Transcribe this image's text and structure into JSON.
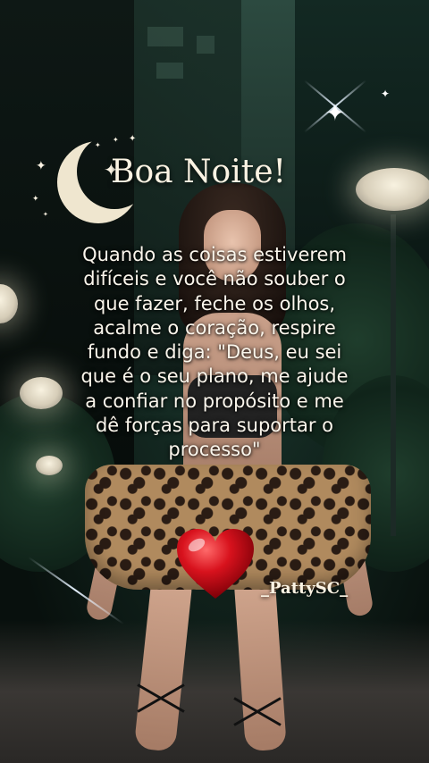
{
  "greeting": {
    "title": "Boa Noite!"
  },
  "message": {
    "lines": [
      "Quando as coisas estiverem",
      "difíceis e você não souber o",
      "que fazer, feche os olhos,",
      "acalme o coração, respire",
      "fundo e diga: \"Deus, eu sei",
      "que é o seu plano, me ajude",
      "a confiar no propósito e me",
      "dê forças para suportar o",
      "processo\""
    ]
  },
  "signature": "_PattySC_",
  "icons": {
    "moon": "crescent-moon-icon",
    "heart": "red-heart-icon",
    "stars": "sparkle-star-icon"
  },
  "colors": {
    "text": "#fbf3e3",
    "moon": "#efe6cf",
    "heart": "#c8101a",
    "background": "#0c1410"
  }
}
